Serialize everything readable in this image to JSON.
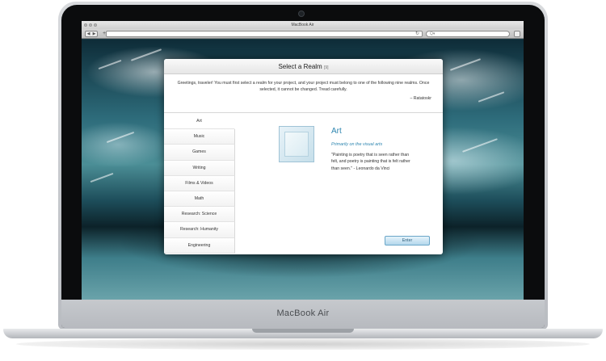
{
  "device": {
    "brand": "MacBook Air"
  },
  "browser": {
    "window_title": "MacBook Air",
    "nav_back": "◀",
    "nav_forward": "▶",
    "new_tab": "+",
    "reload_icon": "reload-icon",
    "search_placeholder": "Q▾"
  },
  "modal": {
    "title": "Select a Realm",
    "count": "[9]",
    "intro": "Greetings, traveler! You must first select a realm for your project, and your project must belong to one of the following nine realms. Once selected, it cannot be changed. Tread carefully.",
    "signature": "– Ratatoskr",
    "realms": [
      {
        "label": "Art",
        "active": true
      },
      {
        "label": "Music",
        "active": false
      },
      {
        "label": "Games",
        "active": false
      },
      {
        "label": "Writing",
        "active": false
      },
      {
        "label": "Films & Videos",
        "active": false
      },
      {
        "label": "Math",
        "active": false
      },
      {
        "label": "Research: Science",
        "active": false
      },
      {
        "label": "Research: Humanity",
        "active": false
      },
      {
        "label": "Engineering",
        "active": false
      }
    ],
    "selected": {
      "title": "Art",
      "subtitle": "Primarily on the visual arts",
      "quote": "\"Painting is poetry that is seen rather than felt, and poetry is painting that is felt rather than seen.\" - Leonardo da Vinci"
    },
    "enter_label": "Enter"
  },
  "colors": {
    "accent": "#2e86b0",
    "button_border": "#6aa6c8"
  }
}
